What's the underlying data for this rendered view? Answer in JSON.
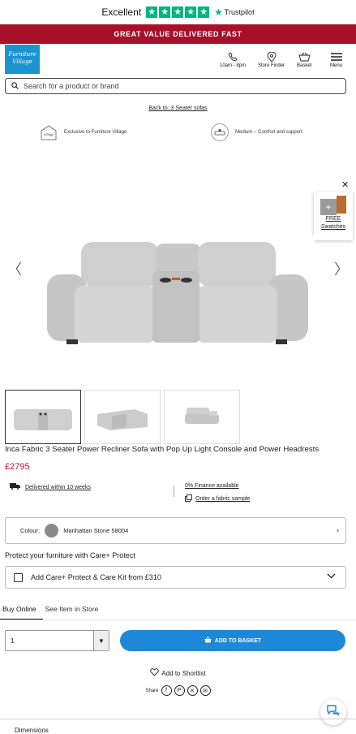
{
  "trustpilot": {
    "rating_label": "Excellent",
    "brand": "Trustpilot"
  },
  "banner": "GREAT VALUE DELIVERED FAST",
  "logo": {
    "line1": "Furniture",
    "line2": "Village"
  },
  "header_nav": [
    {
      "label": "10am - 8pm",
      "icon": "phone-icon"
    },
    {
      "label": "Store Finder",
      "icon": "location-pin-icon"
    },
    {
      "label": "Basket",
      "icon": "basket-icon"
    },
    {
      "label": "Menu",
      "icon": "hamburger-menu-icon"
    }
  ],
  "search": {
    "placeholder": "Search for a product or brand"
  },
  "back_link": "Back to: 3 Seater sofas",
  "features": [
    {
      "text": "Exclusive to Furniture Village",
      "badge": "Furniture Village"
    },
    {
      "text": "Medium – Comfort and support"
    }
  ],
  "swatches": {
    "line1": "FREE",
    "line2": "Swatches"
  },
  "product": {
    "title": "Inca Fabric 3 Seater Power Recliner Sofa with Pop Up Light Console and Power Headrests",
    "price": "£2795"
  },
  "delivery": "Delivered within 10 weeks",
  "finance": "0% Finance available",
  "order_sample": "Order a fabric sample",
  "colour": {
    "label": "Colour:",
    "value": "Manhattan Stone 58004",
    "swatch_color": "#8a8a8a"
  },
  "protect": {
    "title": "Protect your furniture with Care+ Protect",
    "option": "Add Care+ Protect & Care Kit from £310"
  },
  "tabs": [
    "Buy Online",
    "See Item in Store"
  ],
  "quantity": "1",
  "add_to_basket": "ADD TO BASKET",
  "shortlist": "Add to Shortlist",
  "share_label": "Share",
  "dimensions_label": "Dimensions",
  "colors": {
    "brand_blue": "#1d92d0",
    "banner_red": "#a8102a",
    "price_red": "#c8102e",
    "button_blue": "#1e88d8",
    "trustpilot_green": "#00b67a"
  }
}
